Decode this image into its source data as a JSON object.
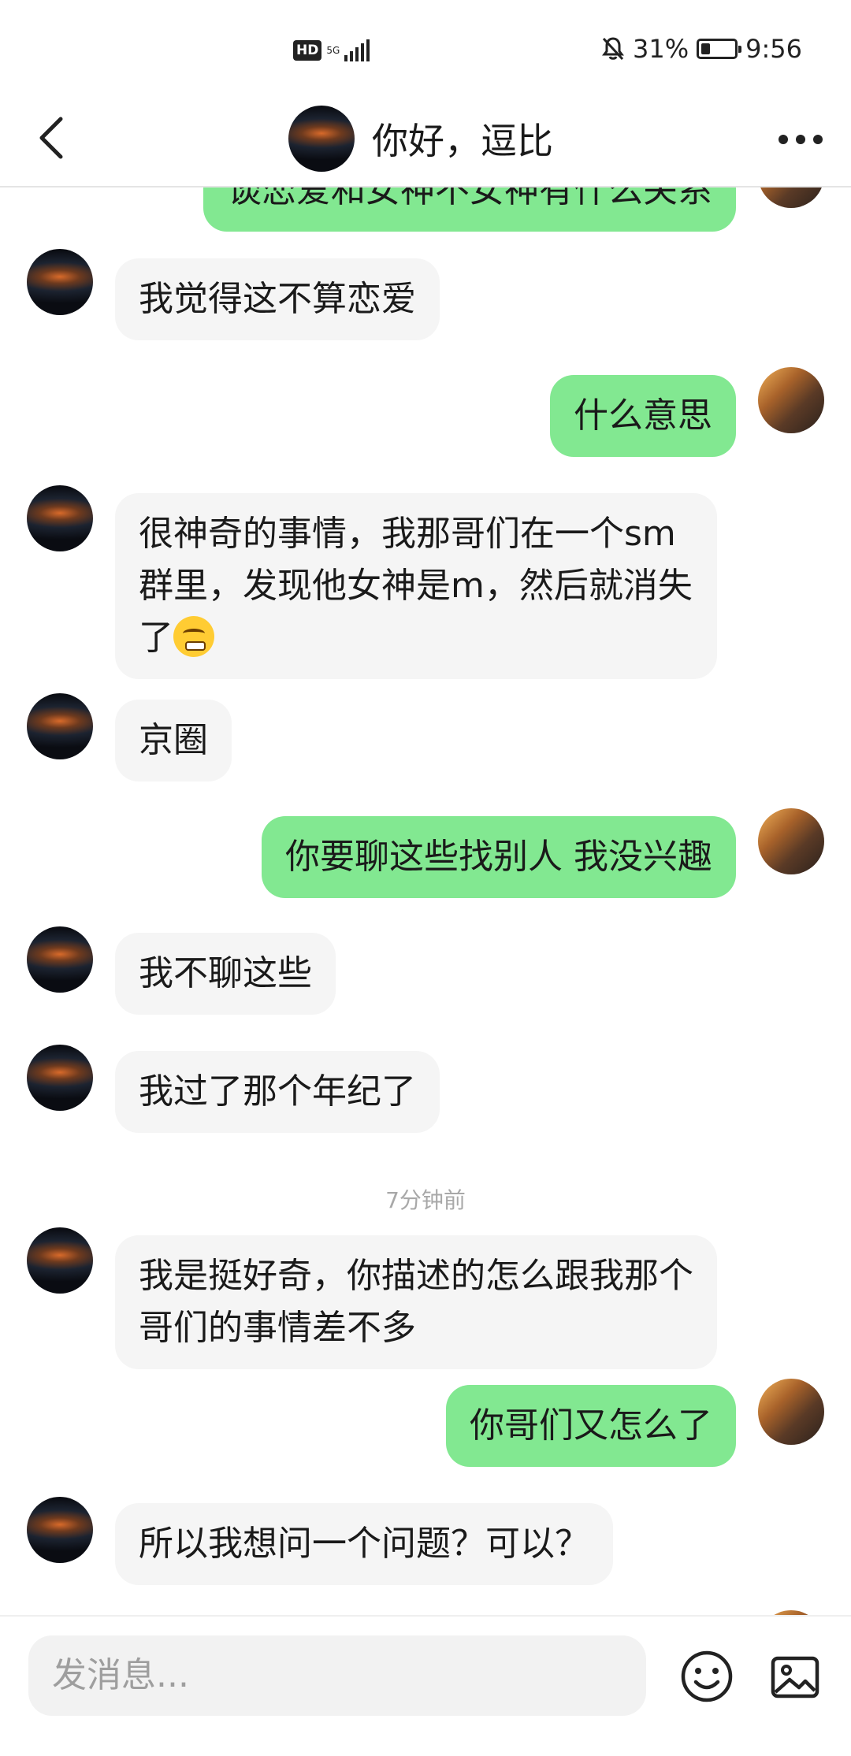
{
  "status_bar": {
    "hd": "HD",
    "network": "5G",
    "battery_percent": "31%",
    "battery_level": 0.31,
    "time": "9:56"
  },
  "header": {
    "title": "你好，逗比",
    "back_icon": "chevron-left-icon",
    "more_icon": "more-horizontal-icon"
  },
  "messages": [
    {
      "side": "out",
      "text": "谈恋爱和女神不女神有什么关系"
    },
    {
      "side": "in",
      "text": "我觉得这不算恋爱"
    },
    {
      "side": "out",
      "text": "什么意思"
    },
    {
      "side": "in",
      "text": "很神奇的事情，我那哥们在一个sm群里，发现他女神是m，然后就消失了",
      "emoji": "steam-from-nose-emoji"
    },
    {
      "side": "in",
      "text": "京圈"
    },
    {
      "side": "out",
      "text": "你要聊这些找别人 我没兴趣"
    },
    {
      "side": "in",
      "text": "我不聊这些"
    },
    {
      "side": "in",
      "text": "我过了那个年纪了"
    },
    {
      "side": "in",
      "text": "我是挺好奇，你描述的怎么跟我那个哥们的事情差不多"
    },
    {
      "side": "out",
      "text": "你哥们又怎么了"
    },
    {
      "side": "in",
      "text": "所以我想问一个问题？可以？"
    }
  ],
  "timestamp": "7分钟前",
  "input": {
    "placeholder": "发消息..."
  },
  "colors": {
    "outgoing_bubble": "#82e891",
    "incoming_bubble": "#f5f5f5",
    "timestamp_text": "#a8a8a8"
  }
}
